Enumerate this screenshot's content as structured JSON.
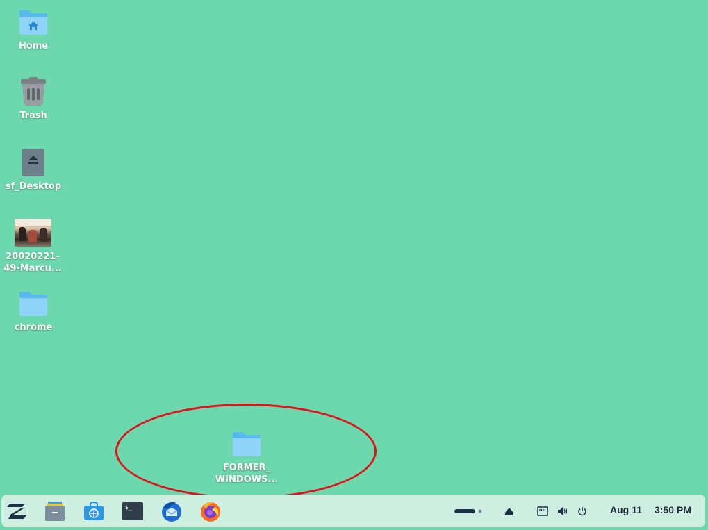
{
  "desktop": {
    "icons": [
      {
        "label": "Home",
        "icon": "home-folder-icon"
      },
      {
        "label": "Trash",
        "icon": "trash-icon"
      },
      {
        "label": "sf_Desktop",
        "icon": "removable-drive-icon"
      },
      {
        "label": "20020221-\n49-Marcu...",
        "icon": "image-thumbnail"
      },
      {
        "label": "chrome",
        "icon": "folder-icon"
      },
      {
        "label": "FORMER_\nWINDOWS...",
        "icon": "folder-icon"
      }
    ],
    "background_color": "#6dd7ae",
    "annotation_color": "#e0131b"
  },
  "taskbar": {
    "apps": [
      {
        "name": "Zorin menu",
        "icon": "zorin-logo-icon"
      },
      {
        "name": "Files",
        "icon": "file-manager-icon"
      },
      {
        "name": "Software",
        "icon": "software-store-icon"
      },
      {
        "name": "Terminal",
        "icon": "terminal-icon"
      },
      {
        "name": "Thunderbird",
        "icon": "thunderbird-icon"
      },
      {
        "name": "Firefox",
        "icon": "firefox-icon"
      }
    ],
    "tray": [
      "workspace-indicator-icon",
      "eject-icon",
      "network-icon",
      "volume-icon",
      "power-icon"
    ],
    "date": "Aug 11",
    "time": "3:50 PM"
  }
}
